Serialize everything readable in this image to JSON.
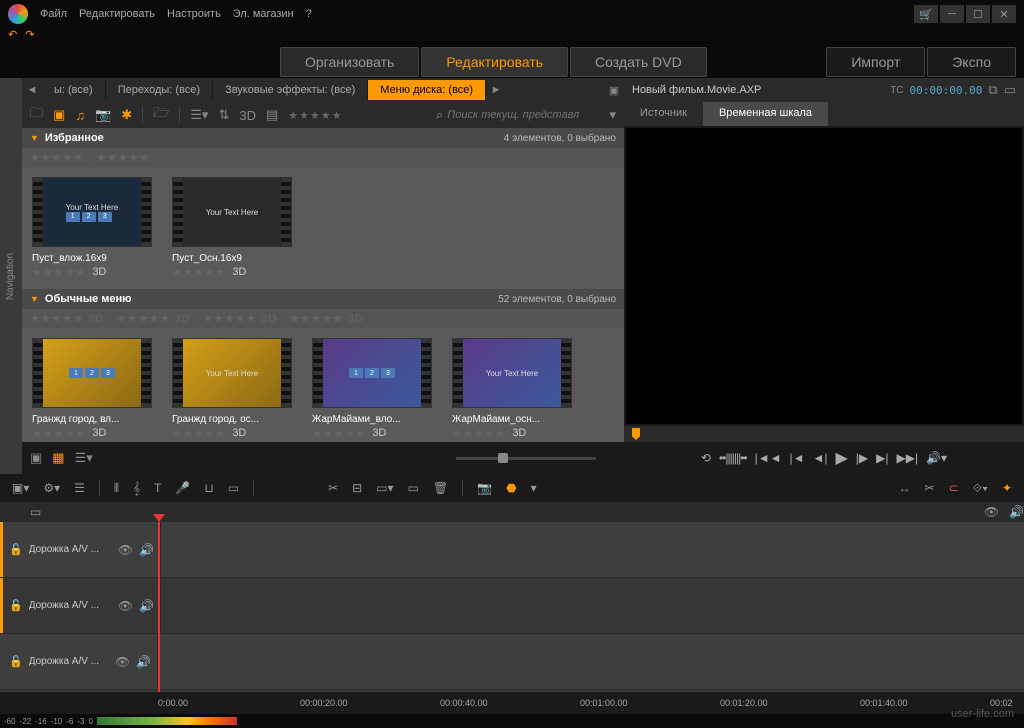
{
  "menu": {
    "file": "Файл",
    "edit": "Редактировать",
    "setup": "Настроить",
    "store": "Эл. магазин"
  },
  "modes": {
    "organize": "Организовать",
    "edit": "Редактировать",
    "dvd": "Создать DVD",
    "import": "Импорт",
    "export": "Экспо"
  },
  "lib": {
    "tabs": {
      "all": "ы: (все)",
      "trans": "Переходы: (все)",
      "sound": "Звуковые эффекты: (все)",
      "disc": "Меню диска: (все)"
    },
    "search_placeholder": "Поиск текущ. представл",
    "cat1": {
      "title": "Избранное",
      "meta": "4 элементов, 0 выбрано"
    },
    "cat2": {
      "title": "Обычные меню",
      "meta": "52 элементов, 0 выбрано"
    },
    "threeD": "3D",
    "items1": [
      "Пуст_влож.16x9",
      "Пуст_Осн.16x9"
    ],
    "items2": [
      "Гранжд город, вл...",
      "Гранжд город, ос...",
      "ЖарМайами_вло...",
      "ЖарМайами_осн..."
    ],
    "yourtext": "Your Text Here"
  },
  "preview": {
    "title": "Новый фильм.Movie.AXP",
    "tc_label": "TC",
    "tc_value": "00:00:00.00",
    "source": "Источник",
    "timeline": "Временная шкала"
  },
  "tracks": {
    "t1": "Дорожка A/V ...",
    "t2": "Дорожка A/V ...",
    "t3": "Дорожка A/V ..."
  },
  "ruler": [
    "0:00.00",
    "00:00:20.00",
    "00:00:40.00",
    "00:01:00.00",
    "00:01:20.00",
    "00:01:40.00",
    "00:02"
  ],
  "db": [
    "-60",
    "-22",
    "-16",
    "-10",
    "-6",
    "-3",
    "0"
  ],
  "watermark": "user-life.com",
  "nav": "Navigation"
}
